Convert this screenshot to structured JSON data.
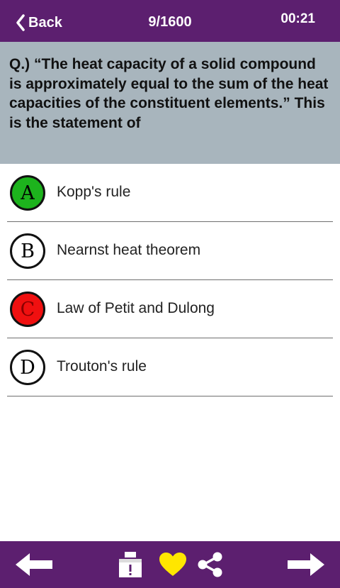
{
  "header": {
    "back_label": "Back",
    "counter": "9/1600",
    "timer": "00:21"
  },
  "question": {
    "text": "Q.) “The heat capacity of a solid compound is approximately equal to the sum of the heat capacities of the constituent elements.” This is the statement of"
  },
  "options": [
    {
      "letter": "A",
      "text": "Kopp's rule",
      "state": "correct",
      "color": "#1db31d"
    },
    {
      "letter": "B",
      "text": "Nearnst heat theorem",
      "state": "neutral",
      "color": "#ffffff"
    },
    {
      "letter": "C",
      "text": "Law of Petit and Dulong",
      "state": "wrong",
      "color": "#f01010"
    },
    {
      "letter": "D",
      "text": "Trouton's rule",
      "state": "neutral",
      "color": "#ffffff"
    }
  ],
  "footer": {
    "icons": [
      "arrow-left-icon",
      "report-box-icon",
      "heart-icon",
      "share-icon",
      "arrow-right-icon"
    ]
  },
  "colors": {
    "bar": "#5c1f6f",
    "question_bg": "#a8b5bd",
    "heart": "#ffe600"
  }
}
